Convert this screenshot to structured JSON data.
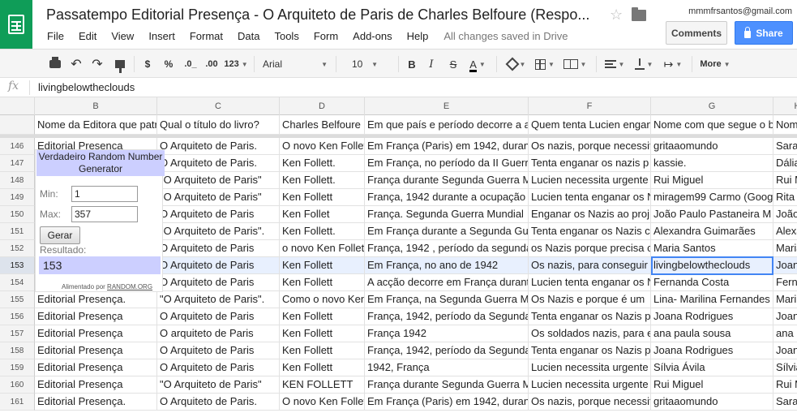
{
  "doc": {
    "title": "Passatempo Editorial Presença - O Arquiteto de Paris de Charles Belfoure (Respo...",
    "user_email": "mmmfrsantos@gmail.com",
    "comments_label": "Comments",
    "share_label": "Share",
    "save_status": "All changes saved in Drive"
  },
  "menu": [
    "File",
    "Edit",
    "View",
    "Insert",
    "Format",
    "Data",
    "Tools",
    "Form",
    "Add-ons",
    "Help"
  ],
  "toolbar": {
    "currency": "$",
    "percent": "%",
    "dec_decrease": ".0_",
    "dec_increase": ".00",
    "number_format": "123",
    "font": "Arial",
    "font_size": "10",
    "bold": "B",
    "italic": "I",
    "strike": "S",
    "text_color": "A",
    "more": "More"
  },
  "formula": {
    "fx": "fx",
    "value": "livingbelowtheclouds"
  },
  "columns": [
    {
      "letter": "B",
      "header": "Nome da Editora que patrocina"
    },
    {
      "letter": "C",
      "header": "Qual o título do livro?"
    },
    {
      "letter": "D",
      "header": "Charles Belfoure"
    },
    {
      "letter": "E",
      "header": "Em que país e período decorre a acção"
    },
    {
      "letter": "F",
      "header": "Quem tenta Lucien enganar?"
    },
    {
      "letter": "G",
      "header": "Nome com que segue o blog"
    },
    {
      "letter": "H",
      "header": "Nome"
    }
  ],
  "rows": [
    {
      "num": "146",
      "cells": [
        "Editorial Presença",
        "O Arquiteto de Paris.",
        "O novo Ken Follett",
        "Em França (Paris) em 1942, durante",
        "Os nazis, porque necessitam",
        "gritaaomundo",
        "Sara"
      ]
    },
    {
      "num": "147",
      "cells": [
        "",
        "O Arquiteto de Paris.",
        "Ken Follett.",
        "Em França, no período da II Guerra",
        "Tenta enganar os nazis p",
        "kassie.",
        "Dália"
      ]
    },
    {
      "num": "148",
      "cells": [
        "",
        "\"O Arquiteto de Paris\"",
        "Ken Follett.",
        "França durante Segunda Guerra Mundial",
        "Lucien necessita urgente",
        "Rui Miguel",
        "Rui M"
      ]
    },
    {
      "num": "149",
      "cells": [
        "",
        "\"O Arquiteto de Paris\"",
        "Ken Follett",
        "França, 1942 durante a ocupação",
        "Lucien tenta enganar os N",
        "miragem99 Carmo (Google",
        "Rita"
      ]
    },
    {
      "num": "150",
      "cells": [
        "",
        "O Arquiteto de Paris",
        "Ken Follet",
        "França. Segunda Guerra Mundial",
        "Enganar os Nazis ao proj",
        "João Paulo Pastaneira M",
        "João"
      ]
    },
    {
      "num": "151",
      "cells": [
        "",
        "\"O Arquiteto de Paris\".",
        "Ken Follett.",
        "Em França durante a Segunda Guerra",
        "Tenta enganar os Nazis c",
        "Alexandra Guimarães",
        "Alexa"
      ]
    },
    {
      "num": "152",
      "cells": [
        "",
        "O Arquiteto de Paris",
        "o novo Ken Follett",
        "França, 1942 , período da segunda",
        "os Nazis porque precisa c",
        "Maria Santos",
        "Maria"
      ]
    },
    {
      "num": "153",
      "cells": [
        "",
        "O Arquiteto de Paris",
        "Ken Follett",
        "Em França, no ano de 1942",
        "Os nazis, para conseguir",
        "livingbelowtheclouds",
        "Joana"
      ]
    },
    {
      "num": "154",
      "cells": [
        "",
        "O Arquiteto de Paris",
        "Ken Follett",
        "A acção decorre em França durante",
        "Lucien tenta enganar os N",
        "Fernanda Costa",
        "Ferna"
      ]
    },
    {
      "num": "155",
      "cells": [
        "Editorial Presença.",
        "\"O Arquiteto de Paris\".",
        "Como o novo Ken",
        "Em França, na Segunda Guerra Mundial",
        "Os Nazis e porque é um",
        "Lina- Marilina Fernandes",
        "Marilin"
      ]
    },
    {
      "num": "156",
      "cells": [
        "Editorial Presença",
        "O Arquiteto de Paris",
        "Ken Follett",
        "França, 1942, período da Segunda",
        "Tenta enganar os Nazis p",
        "Joana Rodrigues",
        "Joana"
      ]
    },
    {
      "num": "157",
      "cells": [
        "Editorial Presença",
        "O arquiteto de Paris",
        "Ken Follett",
        "França 1942",
        "Os soldados nazis, para e",
        "ana paula sousa",
        "ana"
      ]
    },
    {
      "num": "158",
      "cells": [
        "Editorial Presença",
        "O Arquiteto de Paris",
        "Ken Follett",
        "França, 1942, período da Segunda",
        "Tenta enganar os Nazis p",
        "Joana Rodrigues",
        "Joana"
      ]
    },
    {
      "num": "159",
      "cells": [
        "Editorial Presença",
        "O Arquiteto de Paris",
        " Ken Follett",
        "1942, França",
        "Lucien necessita urgente",
        "Sílvia Ávila",
        "Sílvia"
      ]
    },
    {
      "num": "160",
      "cells": [
        "Editorial Presença",
        "\"O Arquiteto de Paris\"",
        "KEN FOLLETT",
        "França durante Segunda Guerra Mundial",
        "Lucien necessita urgente",
        "Rui Miguel",
        "Rui M"
      ]
    },
    {
      "num": "161",
      "cells": [
        "Editorial Presença.",
        "O Arquiteto de Paris.",
        "O novo Ken Follett",
        "Em França (Paris) em 1942, durante",
        "Os nazis, porque necessitam",
        "gritaaomundo",
        "Sara"
      ]
    }
  ],
  "rng": {
    "title": "Verdadeiro Random Number Generator",
    "min_label": "Min:",
    "min_value": "1",
    "max_label": "Max:",
    "max_value": "357",
    "button": "Gerar",
    "result_label": "Resultado:",
    "result_value": "153",
    "credit": "Alimentado por",
    "credit_link": "RANDOM.ORG"
  }
}
